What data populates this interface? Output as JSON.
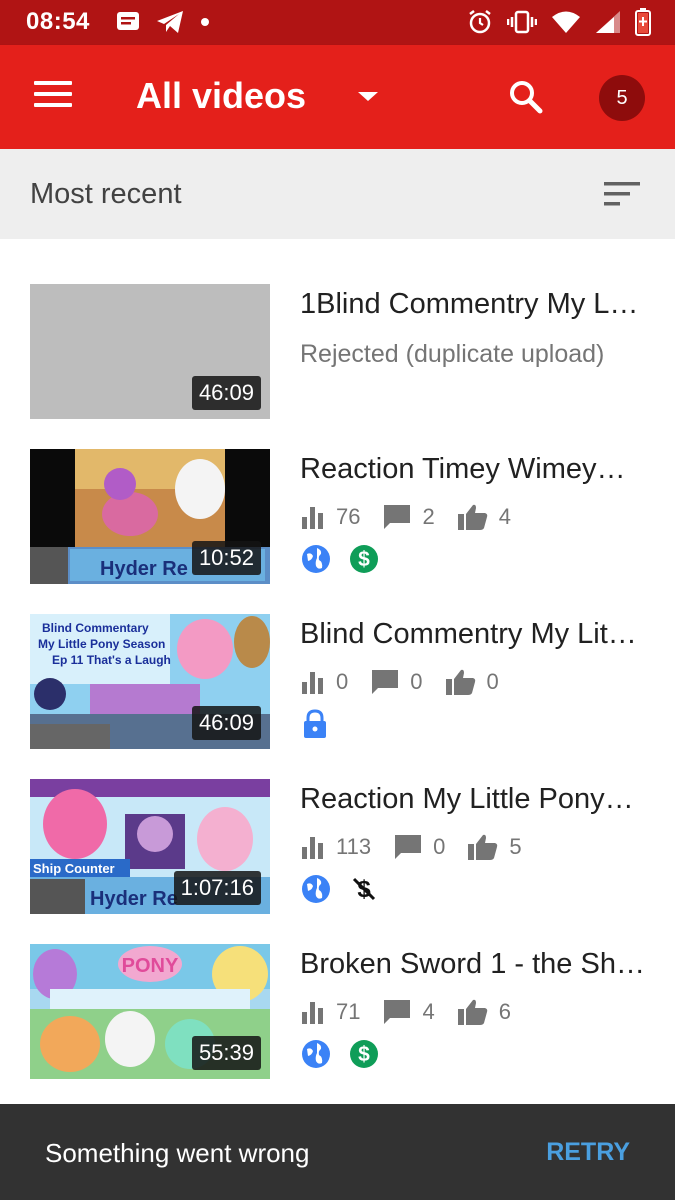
{
  "status_bar": {
    "time": "08:54"
  },
  "app_bar": {
    "title": "All videos",
    "badge_count": "5"
  },
  "sort_bar": {
    "label": "Most recent"
  },
  "videos": [
    {
      "title": "1Blind Commentry My L…",
      "duration": "46:09",
      "status": "Rejected (duplicate upload)"
    },
    {
      "title": "Reaction Timey Wimey…",
      "duration": "10:52",
      "views": "76",
      "comments": "2",
      "likes": "4",
      "visibility": "public",
      "monetization": "monetized"
    },
    {
      "title": "Blind Commentry My Lit…",
      "duration": "46:09",
      "views": "0",
      "comments": "0",
      "likes": "0",
      "visibility": "private"
    },
    {
      "title": "Reaction My Little Pony…",
      "duration": "1:07:16",
      "views": "113",
      "comments": "0",
      "likes": "5",
      "visibility": "public",
      "monetization": "not-monetized"
    },
    {
      "title": "Broken Sword 1 - the Sh…",
      "duration": "55:39",
      "views": "71",
      "comments": "4",
      "likes": "6",
      "visibility": "public",
      "monetization": "monetized"
    }
  ],
  "snackbar": {
    "message": "Something went wrong",
    "action": "RETRY"
  },
  "colors": {
    "app_bar": "#e4201b",
    "status_bar": "#b01414",
    "accent_blue": "#3b82f6",
    "monetized_green": "#0f9d58",
    "snackbar": "#323232"
  }
}
